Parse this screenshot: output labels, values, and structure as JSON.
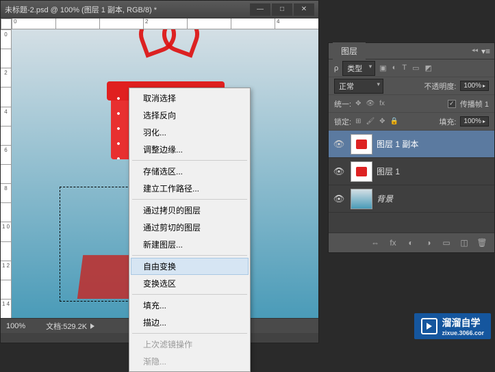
{
  "doc_window": {
    "title": "未标题-2.psd @ 100% (图层 1 副本, RGB/8) *",
    "ruler_h": [
      "0",
      "",
      "",
      "2",
      "",
      "",
      "4"
    ],
    "ruler_v": [
      "0",
      "",
      "2",
      "",
      "4",
      "",
      "6",
      "",
      "8",
      "",
      "1\n0",
      "",
      "1\n2",
      "",
      "1\n4"
    ]
  },
  "statusbar": {
    "zoom": "100%",
    "docinfo": "文档:529.2K"
  },
  "context_menu": [
    {
      "label": "取消选择",
      "sep": false
    },
    {
      "label": "选择反向",
      "sep": false
    },
    {
      "label": "羽化...",
      "sep": false
    },
    {
      "label": "调整边缘...",
      "sep": true
    },
    {
      "label": "存储选区...",
      "sep": false
    },
    {
      "label": "建立工作路径...",
      "sep": true
    },
    {
      "label": "通过拷贝的图层",
      "sep": false
    },
    {
      "label": "通过剪切的图层",
      "sep": false
    },
    {
      "label": "新建图层...",
      "sep": true
    },
    {
      "label": "自由变换",
      "hl": true,
      "sep": false
    },
    {
      "label": "变换选区",
      "sep": true
    },
    {
      "label": "填充...",
      "sep": false
    },
    {
      "label": "描边...",
      "sep": true
    },
    {
      "label": "上次滤镜操作",
      "disabled": true,
      "sep": false
    },
    {
      "label": "渐隐...",
      "disabled": true,
      "sep": false
    }
  ],
  "layers_panel": {
    "tab": "图层",
    "kind_label": "类型",
    "blend": "正常",
    "opacity_label": "不透明度:",
    "opacity": "100%",
    "unify_label": "统一:",
    "propagate_label": "传播帧 1",
    "lock_label": "锁定:",
    "fill_label": "填充:",
    "fill": "100%",
    "layers": [
      {
        "name": "图层 1 副本",
        "selected": true,
        "type": "gift"
      },
      {
        "name": "图层 1",
        "type": "gift"
      },
      {
        "name": "背景",
        "type": "bg"
      }
    ]
  },
  "watermark": {
    "brand": "溜溜自学",
    "url": "zixue.3066.cor"
  }
}
